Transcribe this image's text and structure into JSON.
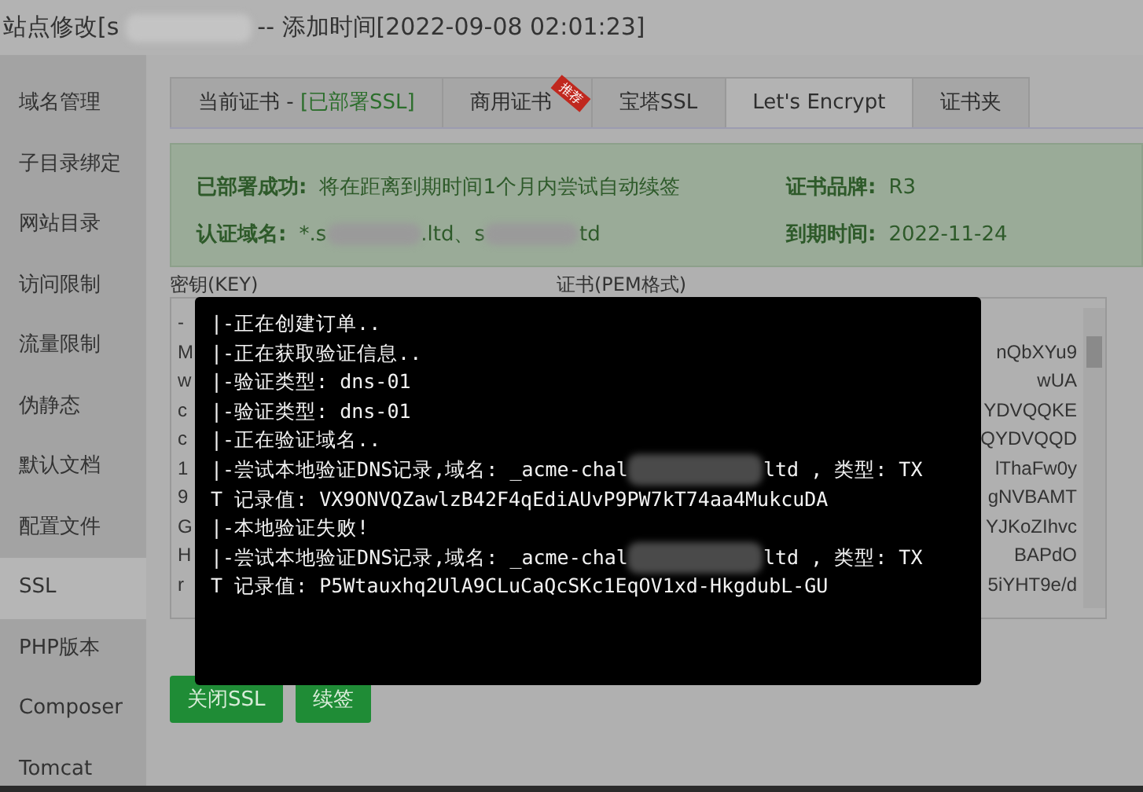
{
  "window": {
    "title_before": "站点修改[s",
    "title_redacted": true,
    "title_after": " -- 添加时间[2022-09-08 02:01:23]"
  },
  "sidebar": {
    "items": [
      {
        "label": "域名管理",
        "selected": false
      },
      {
        "label": "子目录绑定",
        "selected": false
      },
      {
        "label": "网站目录",
        "selected": false
      },
      {
        "label": "访问限制",
        "selected": false
      },
      {
        "label": "流量限制",
        "selected": false
      },
      {
        "label": "伪静态",
        "selected": false
      },
      {
        "label": "默认文档",
        "selected": false
      },
      {
        "label": "配置文件",
        "selected": false
      },
      {
        "label": "SSL",
        "selected": true
      },
      {
        "label": "PHP版本",
        "selected": false
      },
      {
        "label": "Composer",
        "selected": false
      },
      {
        "label": "Tomcat",
        "selected": false
      }
    ]
  },
  "tabs": [
    {
      "label": "当前证书 - ",
      "status": "[已部署SSL]",
      "selected": false
    },
    {
      "label": "商用证书",
      "ribbon": "推荐",
      "selected": false
    },
    {
      "label": "宝塔SSL",
      "selected": false
    },
    {
      "label": "Let's Encrypt",
      "selected": true
    },
    {
      "label": "证书夹",
      "selected": false
    }
  ],
  "status_box": {
    "deployed_label": "已部署成功:",
    "deployed_text": "将在距离到期时间1个月内尝试自动续签",
    "brand_label": "证书品牌:",
    "brand": "R3",
    "domain_label": "认证域名:",
    "domain_parts": [
      {
        "text": "*.s",
        "redacted": true
      },
      {
        "text": ".ltd、s",
        "redacted": true
      },
      {
        "text": "td",
        "redacted": false
      }
    ],
    "expiry_label": "到期时间:",
    "expiry": "2022-11-24"
  },
  "key_label": "密钥(KEY)",
  "cert_label": "证书(PEM格式)",
  "key_lines": [
    "-",
    "M",
    "w",
    "c",
    "c",
    "1",
    "9",
    "G",
    "H",
    "r"
  ],
  "cert_lines": [
    "nQbXYu9",
    "wUA",
    "YDVQQKE",
    "QYDVQQD",
    "lThaFw0y",
    "gNVBAMT",
    "YJKoZIhvc",
    "BAPdO",
    "5iYHT9e/d"
  ],
  "buttons": [
    {
      "label": "关闭SSL"
    },
    {
      "label": "续签"
    }
  ],
  "log": [
    {
      "text": "|-正在创建订单..",
      "redacted": false
    },
    {
      "text": "|-正在获取验证信息..",
      "redacted": false
    },
    {
      "text": "|-验证类型: dns-01",
      "redacted": false
    },
    {
      "text": "|-验证类型: dns-01",
      "redacted": false
    },
    {
      "text": "|-正在验证域名..",
      "redacted": false
    },
    {
      "text": "|-尝试本地验证DNS记录,域名: _acme-chal",
      "redacted": true,
      "rest": "ltd , 类型: TX"
    },
    {
      "text": "T 记录值: VX9ONVQZawlzB42F4qEdiAUvP9PW7kT74aa4MukcuDA",
      "redacted": false
    },
    {
      "text": "|-本地验证失败!",
      "redacted": false
    },
    {
      "text": "|-尝试本地验证DNS记录,域名: _acme-chal",
      "redacted": true,
      "rest": "ltd , 类型: TX"
    },
    {
      "text": "T 记录值: P5Wtauxhq2UlA9CLuCaQcSKc1EqOV1xd-HkgdubL-GU",
      "redacted": false
    }
  ]
}
